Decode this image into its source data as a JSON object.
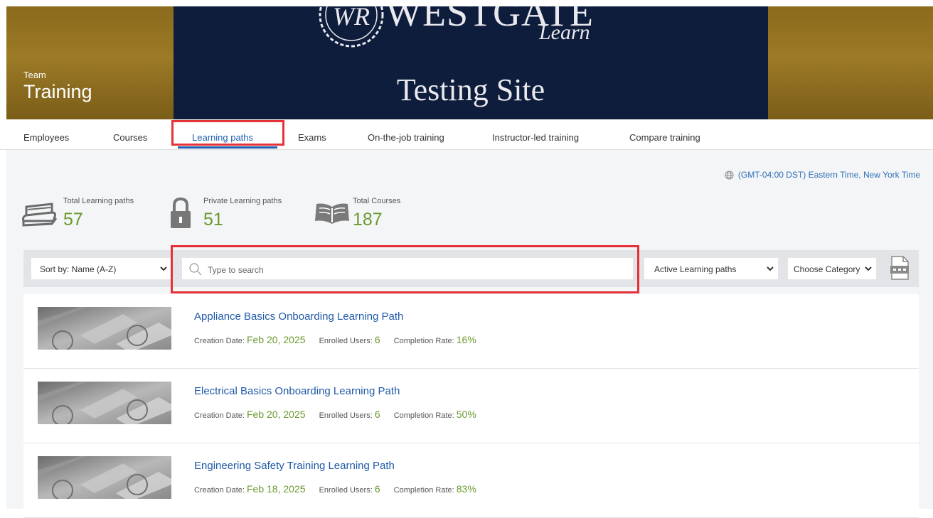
{
  "header": {
    "team_label": "Team",
    "team_title": "Training",
    "brand_mark": "WR",
    "brand_name": "WESTGATE",
    "brand_sub": "Learn",
    "site_title": "Testing Site",
    "colors": {
      "gold": "#8a6a1c",
      "navy": "#0e1d3c",
      "link": "#1c5fb2",
      "green": "#6a9a2e",
      "highlight": "#e53238"
    }
  },
  "nav": {
    "items": [
      {
        "label": "Employees"
      },
      {
        "label": "Courses"
      },
      {
        "label": "Learning paths"
      },
      {
        "label": "Exams"
      },
      {
        "label": "On-the-job training"
      },
      {
        "label": "Instructor-led training"
      },
      {
        "label": "Compare training"
      }
    ],
    "active": "Learning paths"
  },
  "timezone": {
    "icon": "globe-icon",
    "label": "(GMT-04:00 DST) Eastern Time, New York Time"
  },
  "stats": [
    {
      "icon": "books-icon",
      "label": "Total Learning paths",
      "value": "57"
    },
    {
      "icon": "lock-icon",
      "label": "Private Learning paths",
      "value": "51"
    },
    {
      "icon": "open-book-icon",
      "label": "Total Courses",
      "value": "187"
    }
  ],
  "filters": {
    "sort": "Sort by: Name (A-Z)",
    "search_placeholder": "Type to search",
    "status": "Active Learning paths",
    "category": "Choose Category",
    "export_icon": "csv-file-icon"
  },
  "labels": {
    "creation_date": "Creation Date:",
    "enrolled_users": "Enrolled Users:",
    "completion_rate": "Completion Rate:"
  },
  "learning_paths": [
    {
      "title": "Appliance Basics Onboarding Learning Path",
      "creation_date": "Feb 20, 2025",
      "enrolled_users": "6",
      "completion_rate": "16%"
    },
    {
      "title": "Electrical Basics Onboarding Learning Path",
      "creation_date": "Feb 20, 2025",
      "enrolled_users": "6",
      "completion_rate": "50%"
    },
    {
      "title": "Engineering Safety Training Learning Path",
      "creation_date": "Feb 18, 2025",
      "enrolled_users": "6",
      "completion_rate": "83%"
    }
  ]
}
